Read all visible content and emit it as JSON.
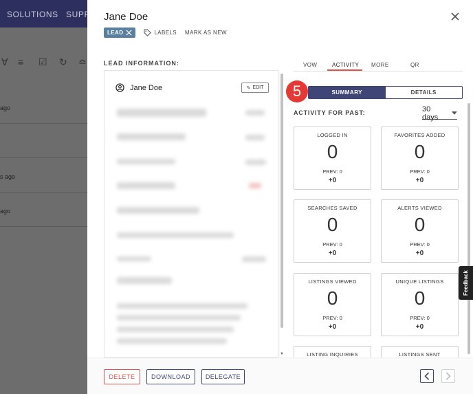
{
  "background": {
    "nav_items": [
      "SOLUTIONS",
      "SUPP"
    ],
    "row_texts": [
      "ago",
      "",
      "s ago",
      "ago"
    ]
  },
  "drawer": {
    "title": "Jane Doe",
    "lead_badge": "LEAD",
    "labels_link": "LABELS",
    "mark_as_new": "MARK AS NEW",
    "section_label": "LEAD INFORMATION:",
    "person_name": "Jane Doe",
    "edit_label": "EDIT"
  },
  "tabs": [
    {
      "label": "VOW"
    },
    {
      "label": "ACTIVITY",
      "active": true
    },
    {
      "label": "MORE"
    },
    {
      "label": "QR"
    }
  ],
  "step_number": "5",
  "segments": {
    "summary": "SUMMARY",
    "details": "DETAILS",
    "selected": "SUMMARY"
  },
  "activity": {
    "label": "ACTIVITY FOR PAST:",
    "period": "30 days",
    "stats": [
      {
        "label": "LOGGED IN",
        "value": "0",
        "prev": "PREV: 0",
        "delta": "+0"
      },
      {
        "label": "FAVORITES ADDED",
        "value": "0",
        "prev": "PREV: 0",
        "delta": "+0"
      },
      {
        "label": "SEARCHES SAVED",
        "value": "0",
        "prev": "PREV: 0",
        "delta": "+0"
      },
      {
        "label": "ALERTS VIEWED",
        "value": "0",
        "prev": "PREV: 0",
        "delta": "+0"
      },
      {
        "label": "LISTINGS VIEWED",
        "value": "0",
        "prev": "PREV: 0",
        "delta": "+0"
      },
      {
        "label": "UNIQUE LISTINGS",
        "value": "0",
        "prev": "PREV: 0",
        "delta": "+0"
      },
      {
        "label": "LISTING INQUIRIES",
        "value": "",
        "prev": "",
        "delta": ""
      },
      {
        "label": "LISTINGS SENT",
        "value": "",
        "prev": "",
        "delta": ""
      }
    ]
  },
  "footer": {
    "delete": "DELETE",
    "download": "DOWNLOAD",
    "delegate": "DELEGATE"
  },
  "feedback": "Feedback",
  "colors": {
    "primary": "#3f4677",
    "danger": "#d9534f",
    "step": "#e53935",
    "badge": "#5b7f9e"
  }
}
